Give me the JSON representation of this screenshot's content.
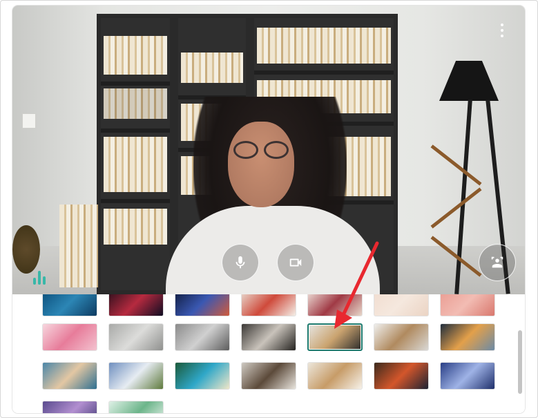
{
  "preview": {
    "more_icon": "more-vert-icon",
    "mic_icon": "microphone-icon",
    "camera_icon": "videocam-icon",
    "effects_icon": "background-effects-icon",
    "audio_level_icon": "audio-level-icon"
  },
  "gallery": {
    "selected_index": 11,
    "thumbnails": [
      {
        "name": "bg-blue-underwater",
        "colors": [
          "#0b4e7a",
          "#2c86b5",
          "#0d3b61"
        ]
      },
      {
        "name": "bg-red-nebula",
        "colors": [
          "#2a0f1c",
          "#b62a3f",
          "#0f0d22"
        ]
      },
      {
        "name": "bg-fireworks",
        "colors": [
          "#0f1b3d",
          "#3a58b2",
          "#d05a3c"
        ]
      },
      {
        "name": "bg-flowers",
        "colors": [
          "#e9e0d6",
          "#cf4a3b",
          "#f4efe8"
        ]
      },
      {
        "name": "bg-floral-pattern",
        "colors": [
          "#f1e6df",
          "#a03a45",
          "#e7d7ca"
        ]
      },
      {
        "name": "bg-pink-plain",
        "colors": [
          "#f1ddd0",
          "#f5e8de",
          "#ebd4c4"
        ]
      },
      {
        "name": "bg-pink-grid",
        "colors": [
          "#ea9c92",
          "#f2bcb3",
          "#d9786e"
        ]
      },
      {
        "name": "bg-pink-blossom",
        "colors": [
          "#f7d6de",
          "#e77c9a",
          "#f3c2cf"
        ]
      },
      {
        "name": "bg-gray-office",
        "colors": [
          "#a9aaa8",
          "#dcdcda",
          "#8f908e"
        ]
      },
      {
        "name": "bg-gray-loft",
        "colors": [
          "#8b8b8b",
          "#d0d0d0",
          "#5c5c5c"
        ]
      },
      {
        "name": "bg-dark-room",
        "colors": [
          "#3b3835",
          "#c9c3bb",
          "#24221f"
        ]
      },
      {
        "name": "bg-bookshelf-room",
        "colors": [
          "#e6e5e2",
          "#caa36f",
          "#2b2b2b"
        ]
      },
      {
        "name": "bg-white-shelves",
        "colors": [
          "#efefed",
          "#b08a5f",
          "#d9d8d5"
        ]
      },
      {
        "name": "bg-glass-house",
        "colors": [
          "#1f2d3d",
          "#e3a04a",
          "#6b8aa6"
        ]
      },
      {
        "name": "bg-beach-arch",
        "colors": [
          "#4a86a8",
          "#e3c7a3",
          "#2e6f91"
        ]
      },
      {
        "name": "bg-mountains",
        "colors": [
          "#6f8fbf",
          "#e6ecf2",
          "#5f7a3c"
        ]
      },
      {
        "name": "bg-tropical-beach",
        "colors": [
          "#1b5a3a",
          "#2fa7c8",
          "#f0e6c8"
        ]
      },
      {
        "name": "bg-horses-fog",
        "colors": [
          "#cfcac2",
          "#5c4a3a",
          "#e8e4dd"
        ]
      },
      {
        "name": "bg-wood-kitchen",
        "colors": [
          "#ece6db",
          "#c79c68",
          "#f6f2ea"
        ]
      },
      {
        "name": "bg-autumn-leaves",
        "colors": [
          "#3b2a1d",
          "#d3562b",
          "#1d2333"
        ]
      },
      {
        "name": "bg-fern-blue",
        "colors": [
          "#2a3f86",
          "#9fb3e6",
          "#1f2f6b"
        ]
      },
      {
        "name": "bg-purple-abstract",
        "colors": [
          "#5a4b8e",
          "#b28fd0",
          "#3b3570"
        ]
      },
      {
        "name": "bg-green-pattern",
        "colors": [
          "#dff0e6",
          "#6cb58a",
          "#f1f7f3"
        ]
      }
    ]
  },
  "annotation": {
    "arrow_color": "#e8282f"
  }
}
